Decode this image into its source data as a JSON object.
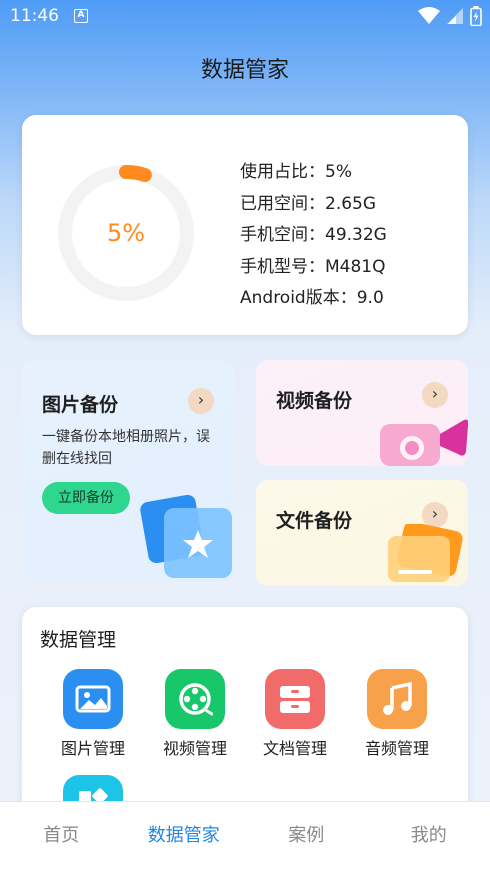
{
  "status_bar": {
    "time": "11:46",
    "notification_badge": "A"
  },
  "header": {
    "title": "数据管家"
  },
  "storage": {
    "percent_label": "5%",
    "usage_fraction": 0.05,
    "rows": [
      "使用占比：5%",
      "已用空间：2.65G",
      "手机空间：49.32G",
      "手机型号：M481Q",
      "Android版本：9.0"
    ],
    "ring_color": "#ff8a1f",
    "track_color": "#f3f3f3"
  },
  "backup": {
    "photo": {
      "title": "图片备份",
      "description": "一键备份本地相册照片，误删在线找回",
      "button_label": "立即备份",
      "arrow": "›"
    },
    "video": {
      "title": "视频备份",
      "arrow": "›"
    },
    "file": {
      "title": "文件备份",
      "arrow": "›"
    }
  },
  "data_management": {
    "title": "数据管理",
    "items": [
      {
        "label": "图片管理",
        "icon": "image-icon",
        "color": "#2a8ff0"
      },
      {
        "label": "视频管理",
        "icon": "film-reel-icon",
        "color": "#17c76a"
      },
      {
        "label": "文档管理",
        "icon": "document-tray-icon",
        "color": "#f26b6b"
      },
      {
        "label": "音频管理",
        "icon": "music-note-icon",
        "color": "#f7a14a"
      },
      {
        "label": "",
        "icon": "apps-icon",
        "color": "#1cc4e8"
      }
    ]
  },
  "tab_bar": {
    "tabs": [
      {
        "label": "首页",
        "active": false
      },
      {
        "label": "数据管家",
        "active": true
      },
      {
        "label": "案例",
        "active": false
      },
      {
        "label": "我的",
        "active": false
      }
    ]
  }
}
